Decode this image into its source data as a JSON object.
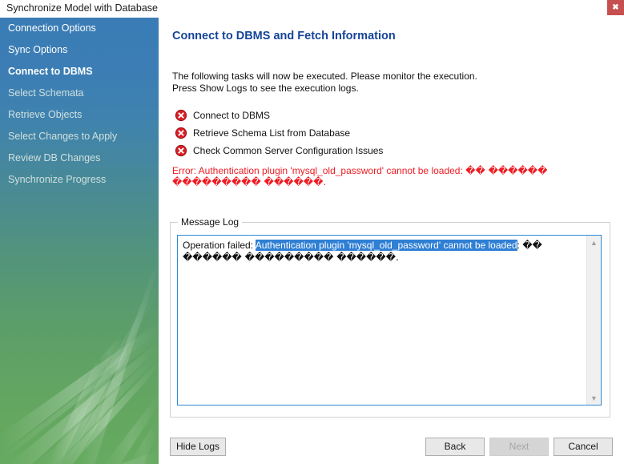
{
  "window": {
    "title": "Synchronize Model with Database",
    "close_label": "✖"
  },
  "sidebar": {
    "items": [
      {
        "label": "Connection Options",
        "state": "done"
      },
      {
        "label": "Sync Options",
        "state": "done"
      },
      {
        "label": "Connect to DBMS",
        "state": "current"
      },
      {
        "label": "Select Schemata",
        "state": "upcoming"
      },
      {
        "label": "Retrieve Objects",
        "state": "upcoming"
      },
      {
        "label": "Select Changes to Apply",
        "state": "upcoming"
      },
      {
        "label": "Review DB Changes",
        "state": "upcoming"
      },
      {
        "label": "Synchronize Progress",
        "state": "upcoming"
      }
    ]
  },
  "main": {
    "page_title": "Connect to DBMS and Fetch Information",
    "intro_line1": "The following tasks will now be executed. Please monitor the execution.",
    "intro_line2": "Press Show Logs to see the execution logs.",
    "tasks": [
      {
        "label": "Connect to DBMS",
        "status": "error",
        "icon": "error-circle-x-icon"
      },
      {
        "label": "Retrieve Schema List from Database",
        "status": "error",
        "icon": "error-circle-x-icon"
      },
      {
        "label": "Check Common Server Configuration Issues",
        "status": "error",
        "icon": "error-circle-x-icon"
      }
    ],
    "error_message": {
      "prefix": "Error: Authentication plugin 'mysql_old_password' cannot be loaded: ",
      "garbled": "�� ������ ��������� ������.",
      "color": "#ee1c22"
    }
  },
  "message_log": {
    "group_title": "Message Log",
    "prefix": "Operation failed: ",
    "selected": "Authentication plugin 'mysql_old_password' cannot be loaded",
    "suffix": ": ",
    "garbled": "�� ������ ��������� ������.",
    "selection_color": "#2f7fd4",
    "scroll_up": "▲",
    "scroll_down": "▼"
  },
  "footer": {
    "hide_logs": "Hide Logs",
    "back": "Back",
    "next": "Next",
    "cancel": "Cancel",
    "next_enabled": false
  },
  "theme": {
    "title_accent": "#16449a",
    "sidebar_top": "#3a7cb5",
    "sidebar_bottom": "#66aa60",
    "close_button": "#c64f4f",
    "error_red": "#ee1c22"
  }
}
